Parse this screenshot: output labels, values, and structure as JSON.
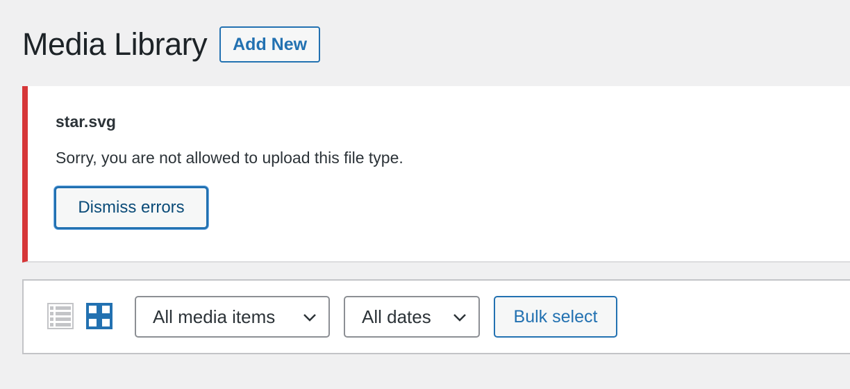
{
  "header": {
    "title": "Media Library",
    "add_new_label": "Add New"
  },
  "error_notice": {
    "file_name": "star.svg",
    "message": "Sorry, you are not allowed to upload this file type.",
    "dismiss_label": "Dismiss errors",
    "accent_color": "#d63638"
  },
  "toolbar": {
    "list_view_icon": "list-view-icon",
    "grid_view_icon": "grid-view-icon",
    "media_filter_value": "All media items",
    "date_filter_value": "All dates",
    "bulk_select_label": "Bulk select",
    "active_view": "grid"
  },
  "colors": {
    "primary": "#2271b1",
    "background": "#f0f0f1",
    "error": "#d63638",
    "inactive_icon": "#c3c4c7"
  }
}
